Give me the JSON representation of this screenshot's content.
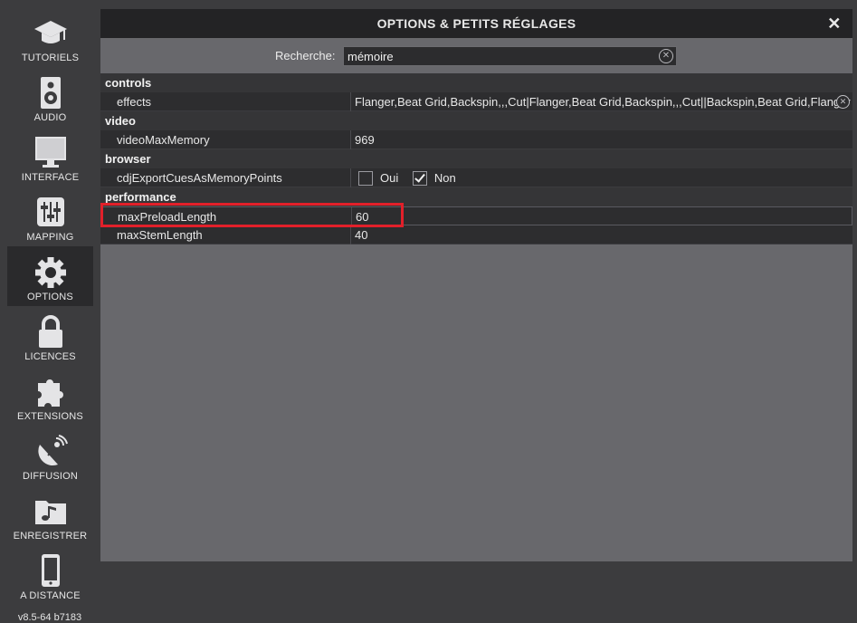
{
  "sidebar": {
    "items": [
      {
        "label": "TUTORIELS",
        "icon": "graduation-cap-icon"
      },
      {
        "label": "AUDIO",
        "icon": "speaker-icon"
      },
      {
        "label": "INTERFACE",
        "icon": "monitor-icon"
      },
      {
        "label": "MAPPING",
        "icon": "sliders-icon"
      },
      {
        "label": "OPTIONS",
        "icon": "gear-icon"
      },
      {
        "label": "LICENCES",
        "icon": "lock-icon"
      },
      {
        "label": "EXTENSIONS",
        "icon": "puzzle-icon"
      },
      {
        "label": "DIFFUSION",
        "icon": "satellite-dish-icon"
      },
      {
        "label": "ENREGISTRER",
        "icon": "music-folder-icon"
      },
      {
        "label": "A DISTANCE",
        "icon": "smartphone-icon"
      }
    ],
    "active": "OPTIONS",
    "version": "v8.5-64 b7183"
  },
  "dialog": {
    "title": "OPTIONS & PETITS RÉGLAGES",
    "close": "✕"
  },
  "search": {
    "label": "Recherche:",
    "value": "mémoire"
  },
  "categories": [
    {
      "name": "controls",
      "options": [
        {
          "name": "effects",
          "value": "Flanger,Beat Grid,Backspin,,,Cut|Flanger,Beat Grid,Backspin,,,Cut||Backspin,Beat Grid,Flanger"
        }
      ]
    },
    {
      "name": "video",
      "options": [
        {
          "name": "videoMaxMemory",
          "value": "969"
        }
      ]
    },
    {
      "name": "browser",
      "options": [
        {
          "name": "cdjExportCuesAsMemoryPoints",
          "choice_yes": "Oui",
          "choice_no": "Non",
          "selected": "Non"
        }
      ]
    },
    {
      "name": "performance",
      "options": [
        {
          "name": "maxPreloadLength",
          "value": "60"
        },
        {
          "name": "maxStemLength",
          "value": "40"
        }
      ]
    }
  ],
  "colors": {
    "highlight_box": "#e2202a",
    "background": "#3c3c3e",
    "panel": "#68686c"
  }
}
